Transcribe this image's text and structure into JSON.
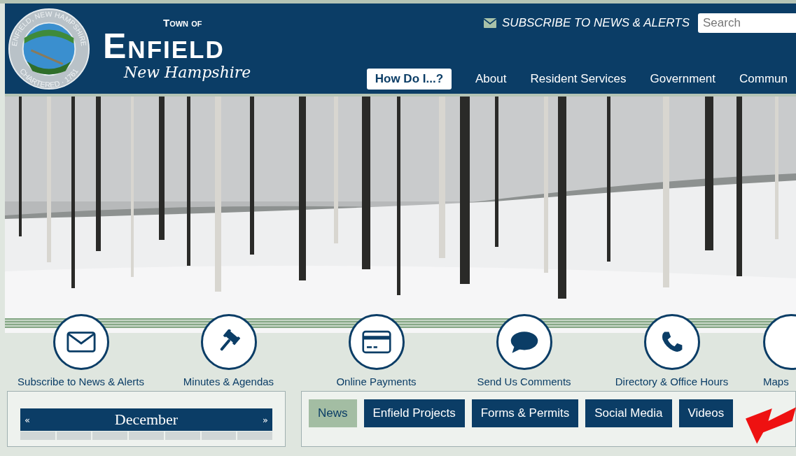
{
  "header": {
    "town_of": "Town of",
    "town": "Enfield",
    "state": "New Hampshire",
    "seal_top": "ENFIELD, NEW HAMPSHIRE",
    "seal_bottom": "CHARTERED · 1761",
    "subscribe": "SUBSCRIBE TO NEWS & ALERTS",
    "search": {
      "placeholder": "Search"
    }
  },
  "nav": [
    {
      "label": "How Do I...?",
      "selected": true
    },
    {
      "label": "About",
      "selected": false
    },
    {
      "label": "Resident Services",
      "selected": false
    },
    {
      "label": "Government",
      "selected": false
    },
    {
      "label": "Commun",
      "selected": false
    }
  ],
  "quick_links": [
    {
      "kind": "envelope",
      "label": "Subscribe to News & Alerts"
    },
    {
      "kind": "gavel",
      "label": "Minutes & Agendas"
    },
    {
      "kind": "card",
      "label": "Online Payments"
    },
    {
      "kind": "speech",
      "label": "Send Us Comments"
    },
    {
      "kind": "phone",
      "label": "Directory & Office Hours"
    },
    {
      "kind": "partial",
      "label": "Maps"
    }
  ],
  "calendar": {
    "prev": "«",
    "month": "December",
    "next": "»"
  },
  "tabs": [
    {
      "label": "News",
      "selected": true
    },
    {
      "label": "Enfield Projects",
      "selected": false
    },
    {
      "label": "Forms & Permits",
      "selected": false
    },
    {
      "label": "Social Media",
      "selected": false
    },
    {
      "label": "Videos",
      "selected": false
    }
  ]
}
